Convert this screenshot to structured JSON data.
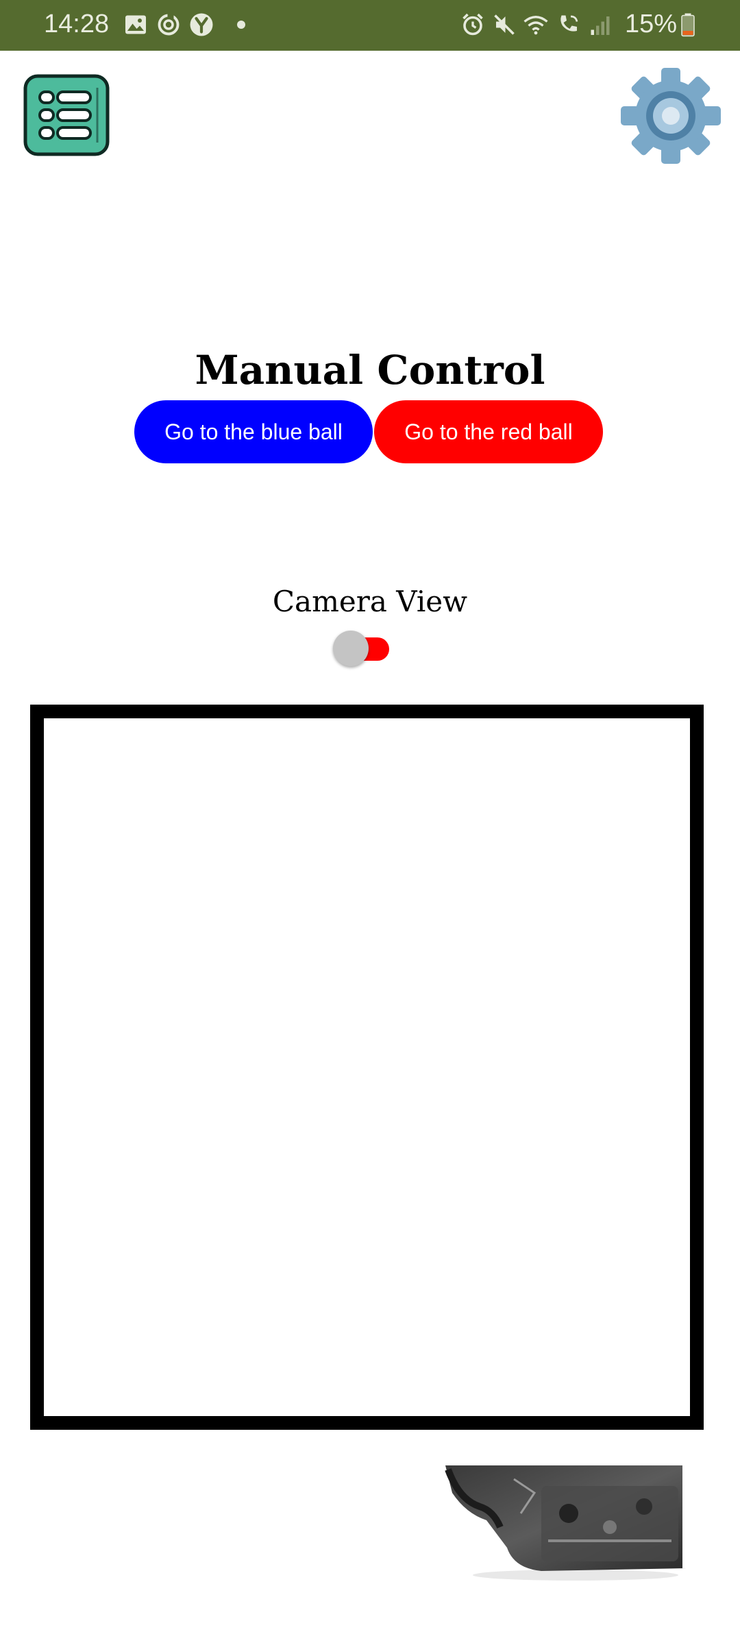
{
  "status_bar": {
    "time": "14:28",
    "battery_percent": "15%",
    "icons": [
      "gallery-icon",
      "sync-icon",
      "y-app-icon",
      "notification-dot-icon",
      "alarm-icon",
      "mute-icon",
      "wifi-icon",
      "wifi-calling-icon",
      "signal-icon",
      "battery-icon"
    ],
    "background_color": "#556b2f"
  },
  "header": {
    "menu_icon": "list-menu-icon",
    "settings_icon": "gear-icon"
  },
  "main": {
    "title": "Manual Control",
    "buttons": [
      {
        "label": "Go to the blue ball",
        "color": "#0000ff"
      },
      {
        "label": "Go to the red ball",
        "color": "#ff0000"
      }
    ],
    "camera": {
      "label": "Camera View",
      "toggle_on": false,
      "toggle_track_color": "#ff0000"
    }
  }
}
